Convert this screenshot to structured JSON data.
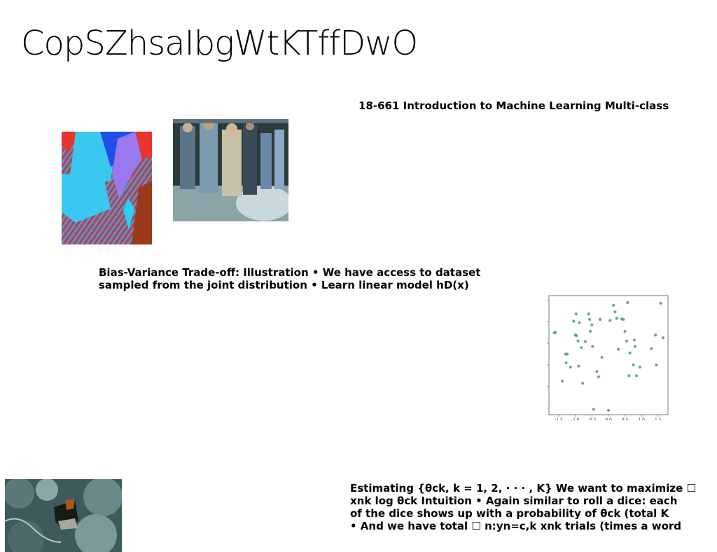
{
  "slide": {
    "title": "CopSZhsaIbgWtKTffDwO",
    "heading": "18-661 Introduction to Machine Learning Multi-class",
    "para1": [
      "Bias-Variance Trade-off: Illustration • We have access to dataset",
      "sampled from the joint distribution • Learn linear model hD(x)"
    ],
    "para2": [
      "Estimating {θck, k = 1, 2, · · · , K} We want to maximize ☐",
      "xnk log θck Intuition • Again similar to roll a dice: each",
      "of the dice shows up with a probability of θck (total K",
      "• And we have total ☐ n:yn=c,k xnk trials (times a word"
    ]
  },
  "chart_data": {
    "type": "scatter",
    "xlim": [
      -1.8,
      1.8
    ],
    "ylim": [
      -3.3,
      2.2
    ],
    "xticks": [
      "-1.5",
      "-1.0",
      "-0.5",
      "0.0",
      "0.5",
      "1.0",
      "1.5"
    ],
    "yticks": [
      "2",
      "1",
      "0",
      "-1",
      "-2",
      "-3"
    ],
    "point_color": "#4a9a7e",
    "points": [
      [
        -1.63,
        0.48
      ],
      [
        -1.61,
        0.5
      ],
      [
        -1.4,
        -1.75
      ],
      [
        -1.28,
        -0.9
      ],
      [
        -1.25,
        -0.5
      ],
      [
        -1.15,
        -1.1
      ],
      [
        -1.05,
        1.02
      ],
      [
        -1.0,
        0.38
      ],
      [
        -0.98,
        1.35
      ],
      [
        -0.97,
        0.35
      ],
      [
        -0.92,
        0.1
      ],
      [
        -0.9,
        -1.05
      ],
      [
        -0.88,
        0.95
      ],
      [
        -0.82,
        -0.2
      ],
      [
        -0.78,
        -1.85
      ],
      [
        -0.7,
        0.08
      ],
      [
        -0.6,
        1.35
      ],
      [
        -0.57,
        1.1
      ],
      [
        -0.55,
        0.55
      ],
      [
        -0.5,
        0.85
      ],
      [
        -0.48,
        -0.15
      ],
      [
        -0.35,
        -1.3
      ],
      [
        -0.3,
        -1.55
      ],
      [
        -0.25,
        1.1
      ],
      [
        -0.2,
        -0.65
      ],
      [
        0.15,
        1.75
      ],
      [
        0.2,
        1.45
      ],
      [
        0.25,
        1.15
      ],
      [
        0.3,
        -0.28
      ],
      [
        0.4,
        1.12
      ],
      [
        0.45,
        1.1
      ],
      [
        0.5,
        0.55
      ],
      [
        0.55,
        0.1
      ],
      [
        0.58,
        1.88
      ],
      [
        0.65,
        -0.45
      ],
      [
        0.75,
        -1.0
      ],
      [
        0.78,
        0.15
      ],
      [
        0.8,
        -0.15
      ],
      [
        0.85,
        -1.5
      ],
      [
        0.95,
        -1.1
      ],
      [
        1.3,
        -0.25
      ],
      [
        1.42,
        0.38
      ],
      [
        1.45,
        -1.0
      ],
      [
        1.58,
        1.85
      ],
      [
        1.65,
        0.25
      ],
      [
        -0.45,
        -3.05
      ],
      [
        0.0,
        -3.1
      ],
      [
        0.05,
        1.05
      ],
      [
        0.62,
        -1.5
      ],
      [
        -1.3,
        -0.5
      ]
    ]
  }
}
